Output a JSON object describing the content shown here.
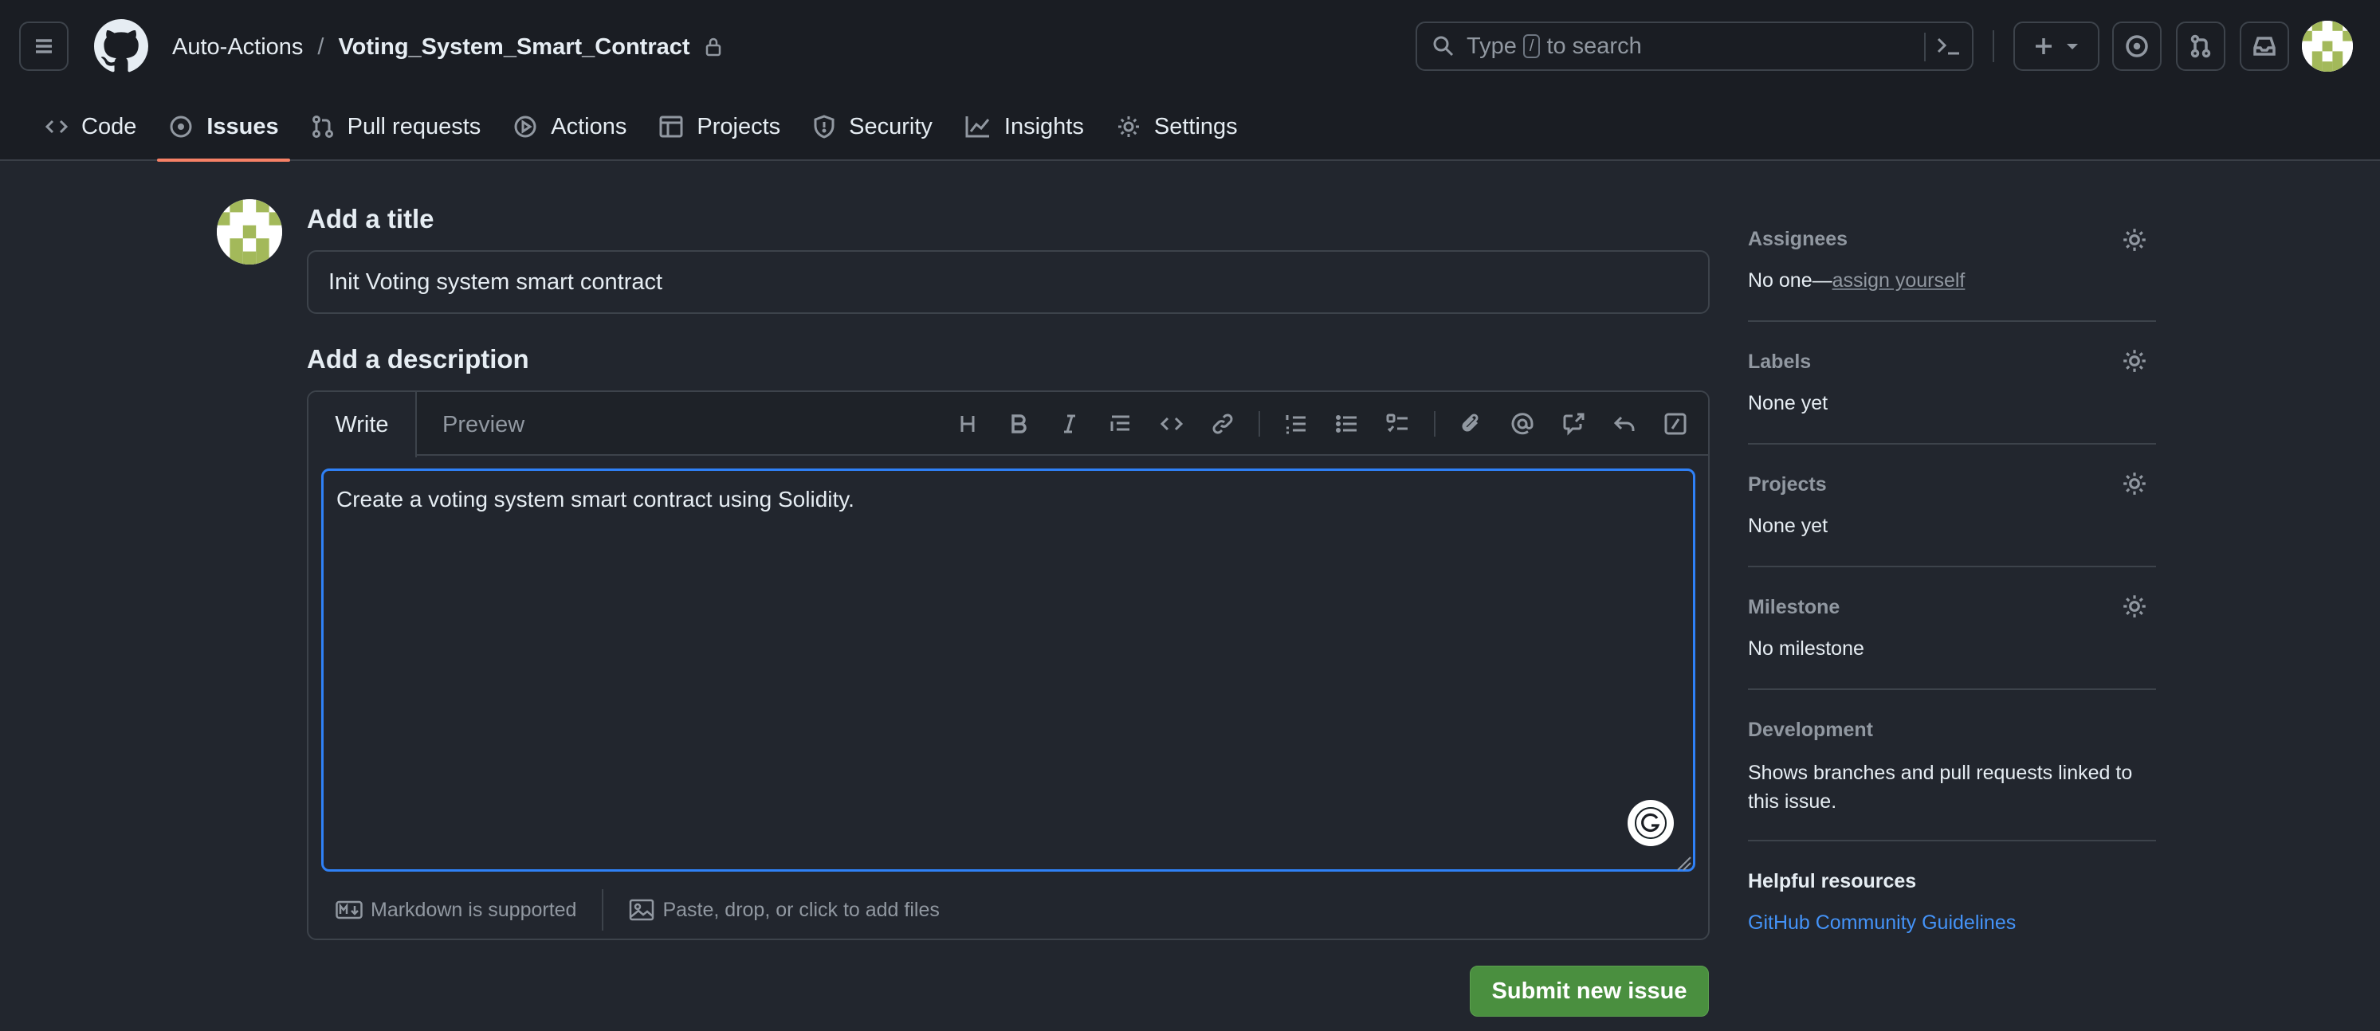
{
  "header": {
    "owner": "Auto-Actions",
    "separator": "/",
    "repo": "Voting_System_Smart_Contract",
    "search_prefix": "Type",
    "search_key": "/",
    "search_suffix": "to search"
  },
  "tabs": [
    {
      "label": "Code",
      "icon": "code-icon"
    },
    {
      "label": "Issues",
      "icon": "issue-opened-icon",
      "active": true
    },
    {
      "label": "Pull requests",
      "icon": "git-pull-request-icon"
    },
    {
      "label": "Actions",
      "icon": "play-icon"
    },
    {
      "label": "Projects",
      "icon": "table-icon"
    },
    {
      "label": "Security",
      "icon": "shield-icon"
    },
    {
      "label": "Insights",
      "icon": "graph-icon"
    },
    {
      "label": "Settings",
      "icon": "gear-icon"
    }
  ],
  "form": {
    "title_heading": "Add a title",
    "title_value": "Init Voting system smart contract",
    "description_heading": "Add a description",
    "write_tab": "Write",
    "preview_tab": "Preview",
    "description_value": "Create a voting system smart contract using Solidity.",
    "markdown_note": "Markdown is supported",
    "files_note": "Paste, drop, or click to add files",
    "submit_label": "Submit new issue"
  },
  "sidebar": {
    "assignees": {
      "title": "Assignees",
      "none": "No one—",
      "link": "assign yourself"
    },
    "labels": {
      "title": "Labels",
      "value": "None yet"
    },
    "projects": {
      "title": "Projects",
      "value": "None yet"
    },
    "milestone": {
      "title": "Milestone",
      "value": "No milestone"
    },
    "development": {
      "title": "Development",
      "value": "Shows branches and pull requests linked to this issue."
    },
    "helpful": {
      "title": "Helpful resources",
      "link": "GitHub Community Guidelines"
    }
  },
  "colors": {
    "accent_underline": "#f78166",
    "submit_green": "#4a8f3f",
    "focus_blue": "#2f81f7",
    "link_blue": "#4493f8"
  }
}
